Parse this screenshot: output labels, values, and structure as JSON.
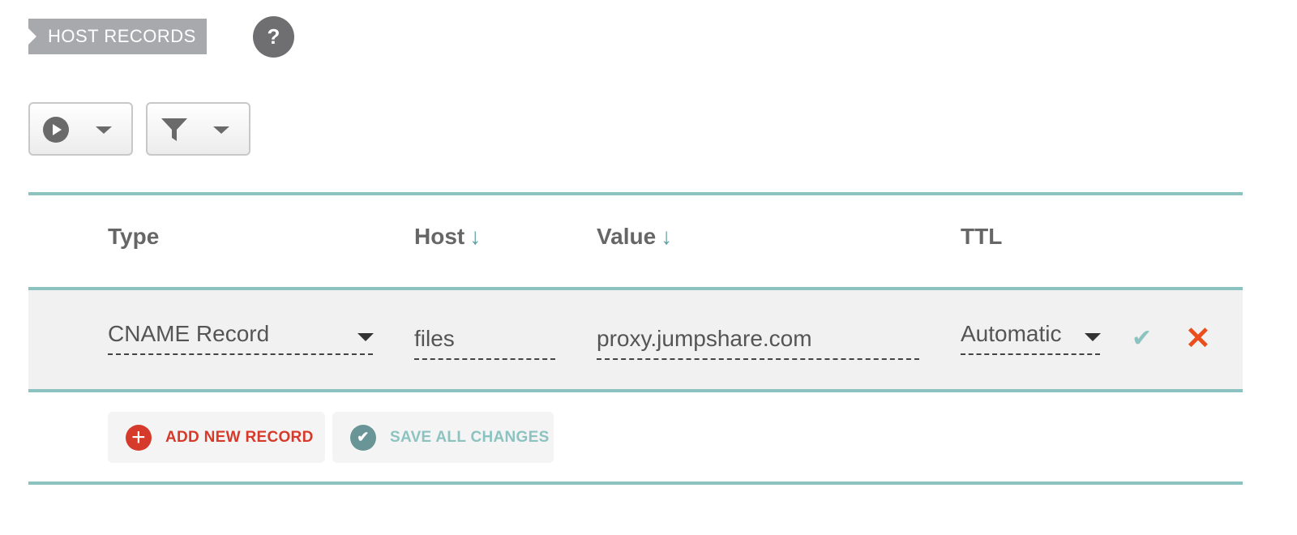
{
  "section": {
    "title": "HOST RECORDS",
    "help_label": "?"
  },
  "toolbar": {
    "play_icon": "play-circle-icon",
    "filter_icon": "funnel-icon"
  },
  "table": {
    "columns": [
      {
        "label": "Type",
        "sort": ""
      },
      {
        "label": "Host",
        "sort": "↓"
      },
      {
        "label": "Value",
        "sort": "↓"
      },
      {
        "label": "TTL",
        "sort": ""
      }
    ],
    "row": {
      "type": "CNAME Record",
      "host": "files",
      "value": "proxy.jumpshare.com",
      "ttl": "Automatic",
      "confirm_icon": "✔",
      "cancel_icon": "✕"
    }
  },
  "actions": {
    "add_label": "ADD NEW RECORD",
    "add_icon": "+",
    "save_label": "SAVE ALL CHANGES",
    "save_icon": "✔"
  },
  "colors": {
    "accent": "#8cc3c0",
    "danger": "#d63a2b",
    "cancel": "#ea4e1c"
  }
}
